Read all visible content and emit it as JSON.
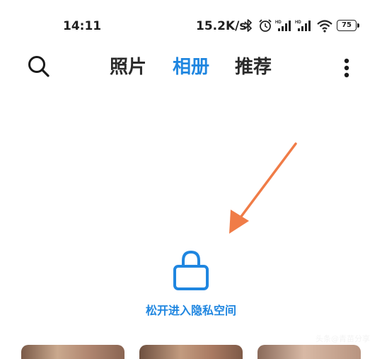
{
  "status_bar": {
    "time": "14:11",
    "net_speed": "15.2K/s",
    "battery": "75",
    "icons": [
      "bluetooth-icon",
      "alarm-icon",
      "hd-signal-icon",
      "hd-signal-icon",
      "wifi-icon",
      "battery-icon"
    ]
  },
  "header": {
    "tabs": [
      {
        "label": "照片",
        "active": false
      },
      {
        "label": "相册",
        "active": true
      },
      {
        "label": "推荐",
        "active": false
      }
    ]
  },
  "main": {
    "private_space_label": "松开进入隐私空间"
  },
  "watermark": "头条@青苗分享",
  "colors": {
    "accent": "#1f86e0",
    "arrow": "#f07c47",
    "text": "#2a2a2a",
    "background": "#ffffff"
  }
}
